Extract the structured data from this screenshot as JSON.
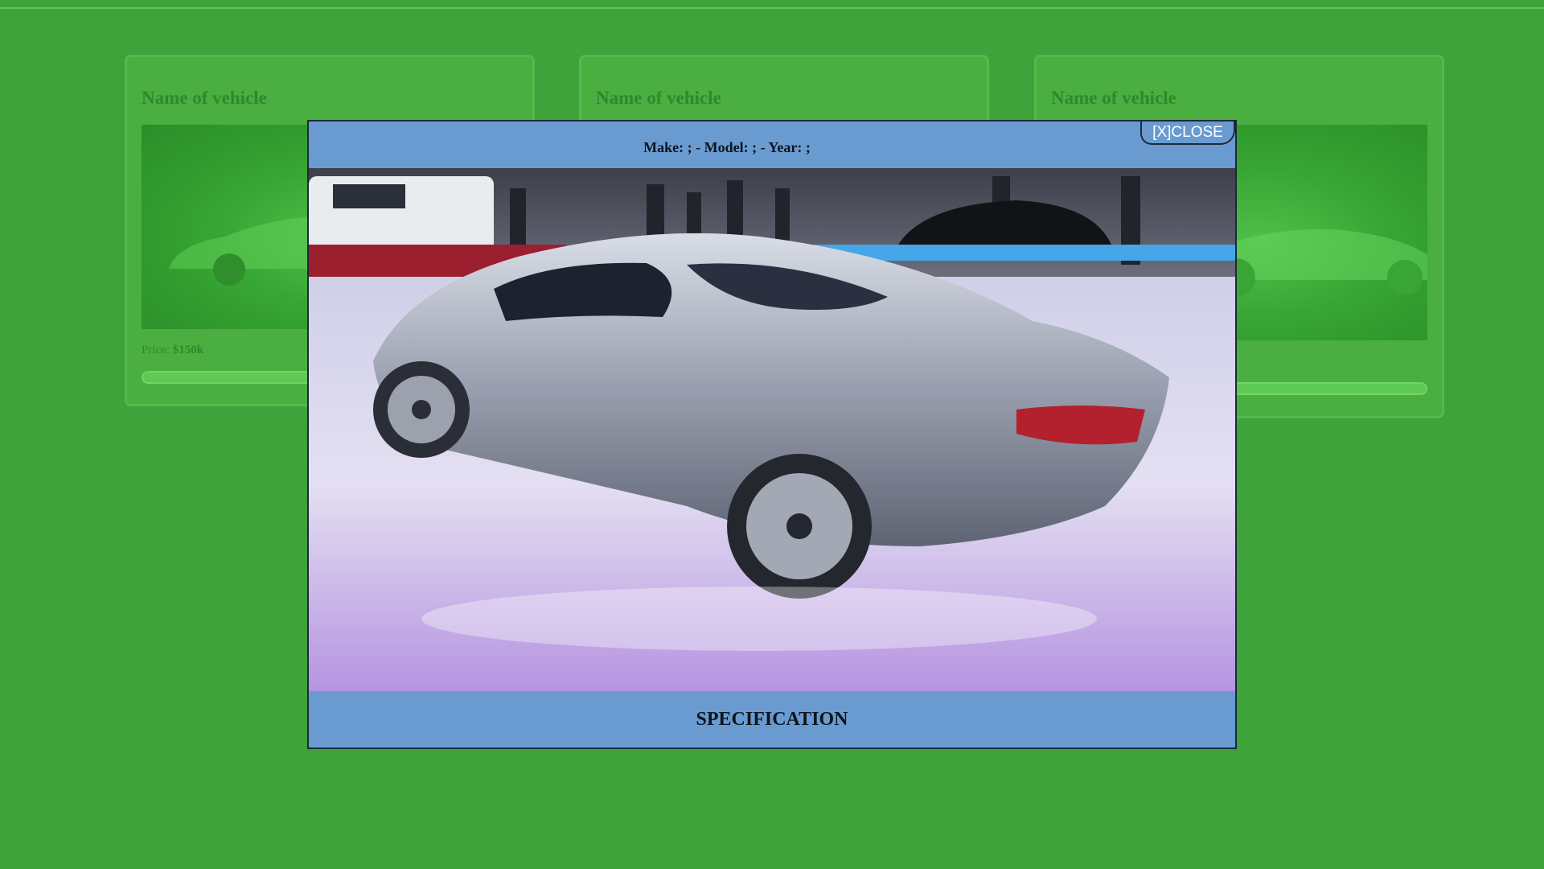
{
  "cards": [
    {
      "title": "Name of vehicle",
      "price_label": "Price:",
      "price_value": "$150k",
      "image": "vehicle-photo"
    },
    {
      "title": "Name of vehicle",
      "image": "vehicle-photo"
    },
    {
      "title": "Name of vehicle",
      "image": "vehicle-photo"
    }
  ],
  "modal": {
    "meta": "Make: ; - Model: ; - Year: ;",
    "close_label": "[X]CLOSE",
    "photo": "silver-supercar-photo",
    "spec_heading": "SPECIFICATION"
  },
  "colors": {
    "page_background": "#3ea33a",
    "card_background": "#4aae40",
    "modal_background": "#6a9bd0",
    "card_text": "#2c8a2c"
  }
}
